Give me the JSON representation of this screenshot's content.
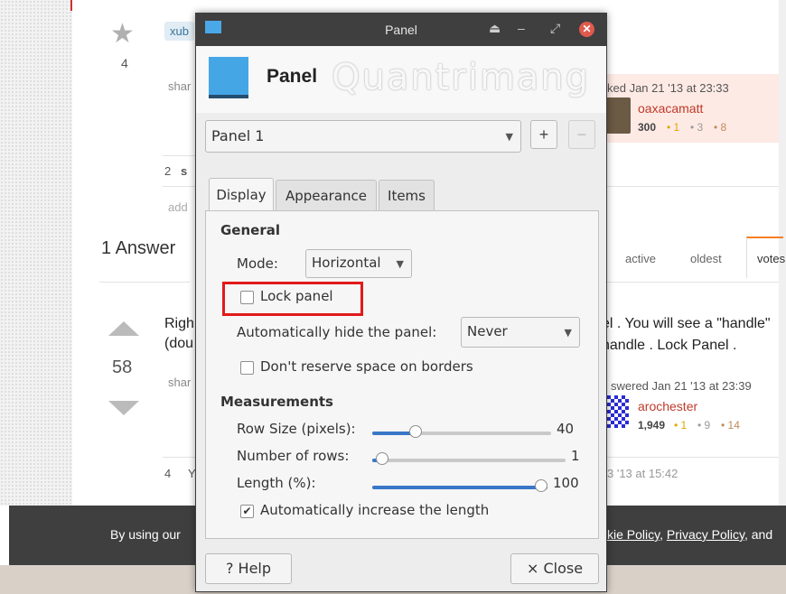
{
  "background_page": {
    "vote_count_question": "4",
    "tag_partial": "xub",
    "share_partial_1": "shar",
    "comments_count": "2",
    "comment_partial": "s",
    "add_partial": "add",
    "answers_heading": "1 Answer",
    "sort_tabs": [
      "active",
      "oldest",
      "votes"
    ],
    "asked_text": "ked Jan 21 '13 at 23:33",
    "asker_name": "oaxacamatt",
    "asker_rep": "300",
    "asker_badges": [
      "• 1",
      "• 3",
      "• 8"
    ],
    "answer_text_left_1": "Righ",
    "answer_text_left_2": "(dou",
    "answer_text_right_1": "el . You will see a \"handle\"",
    "answer_text_right_2": "handle . Lock Panel .",
    "answer_votes": "58",
    "share_partial_2": "shar",
    "answered_text": "swered Jan 21 '13 at 23:39",
    "answerer_name": "arochester",
    "answerer_rep": "1,949",
    "answerer_badges": [
      "• 1",
      "• 9",
      "• 14"
    ],
    "comment2_count": "4",
    "comment2_partial": "Y",
    "comment2_date": "3 '13 at 15:42",
    "cookie_left": "By using our",
    "cookie_right_1": "kie Policy",
    "cookie_right_2": ", ",
    "cookie_right_3": "Privacy Policy",
    "cookie_right_4": ", and"
  },
  "dialog": {
    "window_title": "Panel",
    "titlebar_buttons": [
      "⏏",
      "–",
      "⤢",
      "✕"
    ],
    "header_title": "Panel",
    "watermark_text": "Quantrimang",
    "panel_select": "Panel 1",
    "add_button": "+",
    "remove_button": "−",
    "tabs": [
      "Display",
      "Appearance",
      "Items"
    ],
    "active_tab": "Display",
    "general": {
      "heading": "General",
      "mode_label": "Mode:",
      "mode_value": "Horizontal",
      "lock_panel_label": "Lock panel",
      "lock_panel_checked": false,
      "autohide_label": "Automatically hide the panel:",
      "autohide_value": "Never",
      "dont_reserve_label": "Don't reserve space on borders",
      "dont_reserve_checked": false
    },
    "measurements": {
      "heading": "Measurements",
      "row_size_label": "Row Size (pixels):",
      "row_size_value": "40",
      "row_size_fraction": 0.24,
      "rows_label": "Number of rows:",
      "rows_value": "1",
      "rows_fraction": 0.05,
      "length_label": "Length (%):",
      "length_value": "100",
      "length_fraction": 1.0,
      "auto_increase_label": "Automatically increase the length",
      "auto_increase_checked": true
    },
    "help_button": "? Help",
    "close_button": "× Close"
  },
  "colors": {
    "accent_blue": "#3a77c9",
    "highlight_red": "#e21a1a",
    "titlebar": "#3f3f3f",
    "link_red": "#c0392b"
  }
}
